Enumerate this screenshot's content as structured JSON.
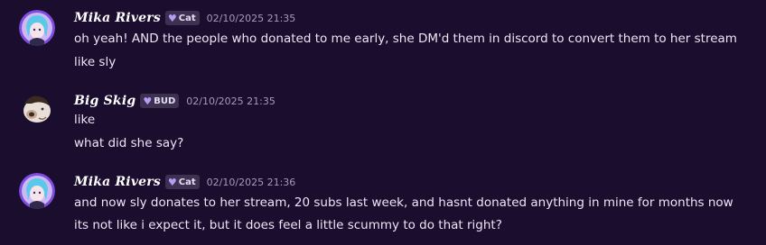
{
  "messages": [
    {
      "username": "Mika Rivers",
      "tag_label": "Cat",
      "timestamp": "02/10/2025 21:35",
      "lines": [
        "oh yeah! AND the people who donated to me early, she DM'd them in discord to convert them to her stream",
        "like sly"
      ]
    },
    {
      "username": "Big Skig",
      "tag_label": "BUD",
      "timestamp": "02/10/2025 21:35",
      "lines": [
        "like",
        "what did she say?"
      ]
    },
    {
      "username": "Mika Rivers",
      "tag_label": "Cat",
      "timestamp": "02/10/2025 21:36",
      "lines": [
        "and now sly donates to her stream, 20 subs last week, and hasnt donated anything in mine for months now",
        "its not like i expect it, but it does feel a little scummy to do that right?"
      ]
    }
  ],
  "icons": {
    "tag_icon": "heart-icon"
  },
  "colors": {
    "background": "#1a0d2e",
    "tag_background": "#3d3152",
    "heart": "#b79bf5",
    "timestamp": "#a69bb8"
  }
}
